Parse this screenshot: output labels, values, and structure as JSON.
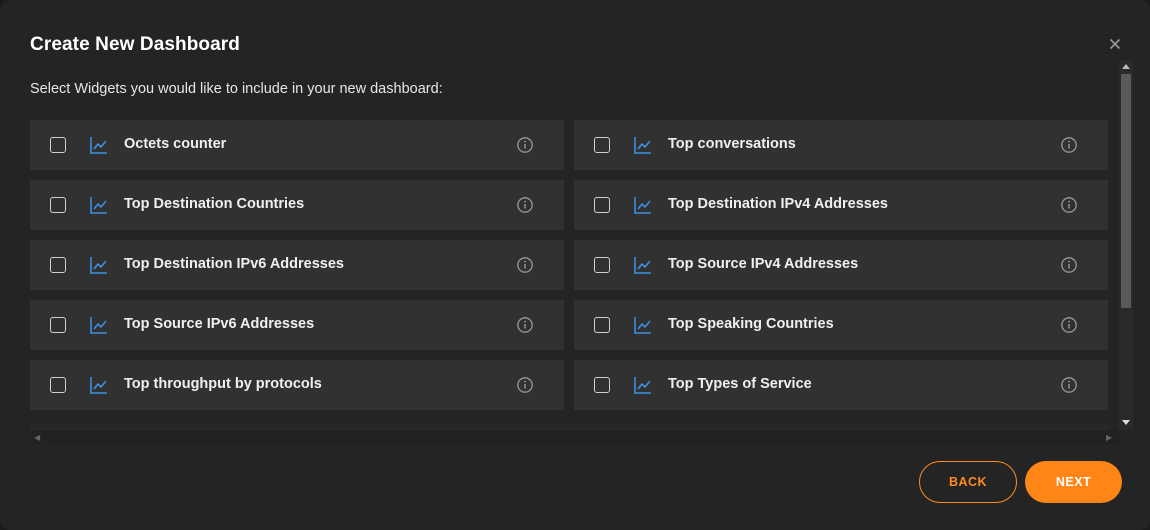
{
  "dialog": {
    "title": "Create New Dashboard",
    "subtitle": "Select Widgets you would like to include in your new dashboard:",
    "close_icon": "close-icon"
  },
  "widgets": [
    {
      "label": "Octets counter",
      "checked": false
    },
    {
      "label": "Top conversations",
      "checked": false
    },
    {
      "label": "Top Destination Countries",
      "checked": false
    },
    {
      "label": "Top Destination IPv4 Addresses",
      "checked": false
    },
    {
      "label": "Top Destination IPv6 Addresses",
      "checked": false
    },
    {
      "label": "Top Source IPv4 Addresses",
      "checked": false
    },
    {
      "label": "Top Source IPv6 Addresses",
      "checked": false
    },
    {
      "label": "Top Speaking Countries",
      "checked": false
    },
    {
      "label": "Top throughput by protocols",
      "checked": false
    },
    {
      "label": "Top Types of Service",
      "checked": false
    }
  ],
  "icons": {
    "widget_icon": "line-chart-icon",
    "info_icon": "info-icon"
  },
  "buttons": {
    "back_label": "BACK",
    "next_label": "NEXT"
  },
  "colors": {
    "accent": "#ff8616",
    "chart_icon": "#3d8fe0",
    "background": "#242424",
    "item_background": "#313131"
  }
}
